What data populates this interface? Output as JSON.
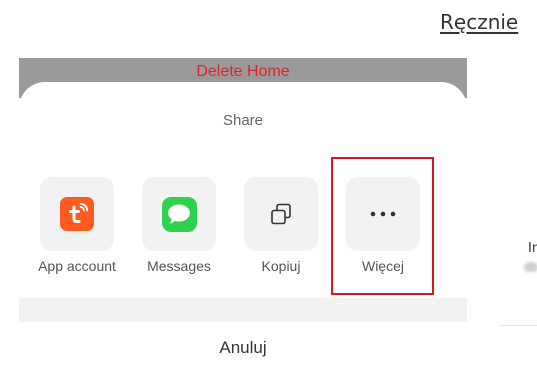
{
  "background": {
    "manual_link": "Ręcznie",
    "right_label": "In"
  },
  "dim_bar": {
    "delete_label": "Delete Home"
  },
  "share_sheet": {
    "title": "Share",
    "options": [
      {
        "label": "App account",
        "icon": "tuya-app-icon"
      },
      {
        "label": "Messages",
        "icon": "messages-icon"
      },
      {
        "label": "Kopiuj",
        "icon": "copy-icon"
      },
      {
        "label": "Więcej",
        "icon": "more-dots-icon"
      }
    ],
    "cancel_label": "Anuluj"
  },
  "colors": {
    "delete_red": "#e02424",
    "highlight_red": "#d9141f",
    "tuya_orange": "#ff5a1f",
    "messages_green": "#2fd24f"
  }
}
